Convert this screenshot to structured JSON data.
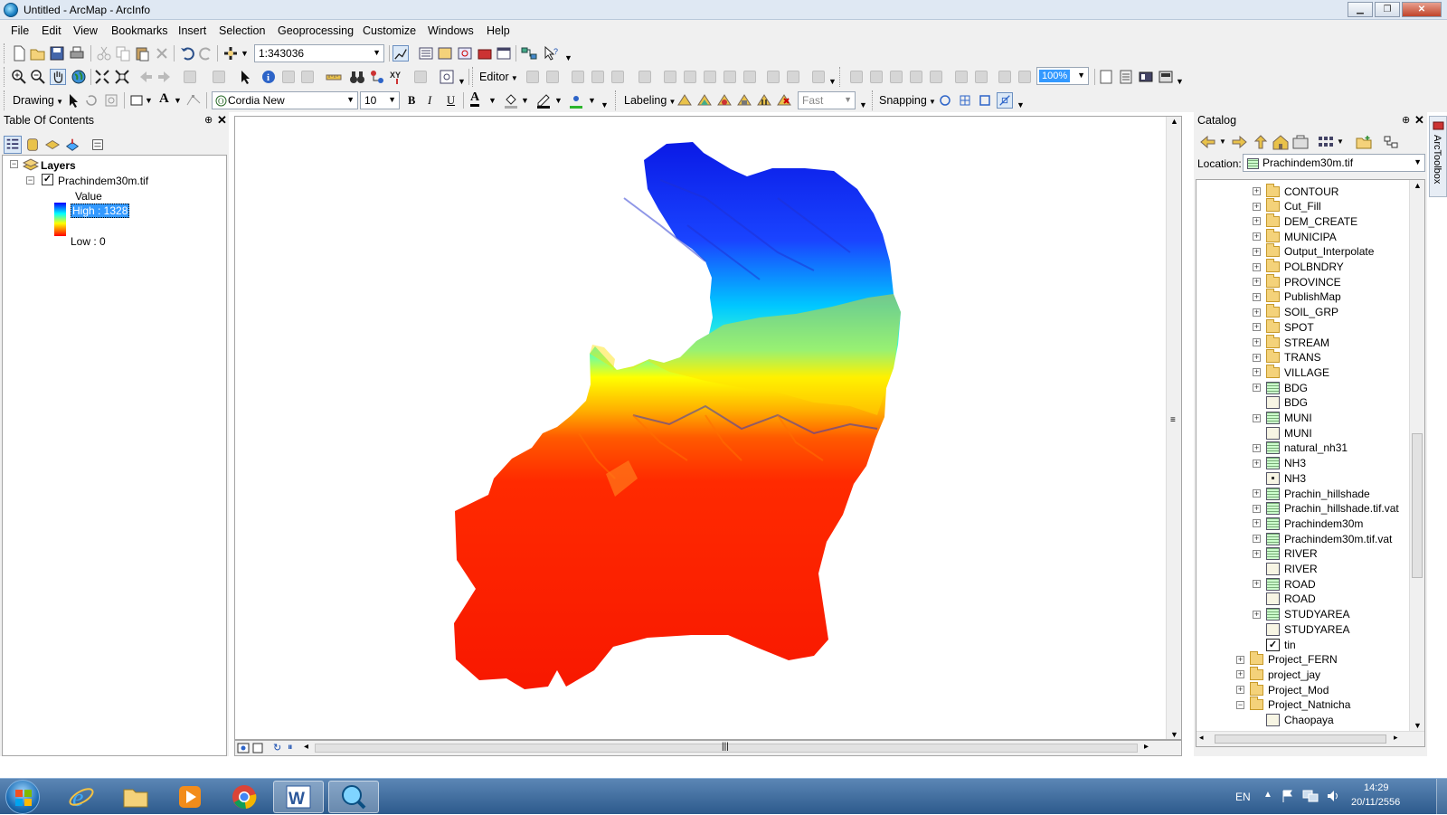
{
  "window": {
    "title": "Untitled - ArcMap - ArcInfo"
  },
  "menu": [
    "File",
    "Edit",
    "View",
    "Bookmarks",
    "Insert",
    "Selection",
    "Geoprocessing",
    "Customize",
    "Windows",
    "Help"
  ],
  "toolbar": {
    "scale": "1:343036",
    "editor": "Editor",
    "zoom_pct": "100%",
    "font_name": "Cordia New",
    "font_size": "10",
    "bold": "B",
    "italic": "I",
    "underline": "U",
    "text_A": "A",
    "drawing": "Drawing",
    "labeling": "Labeling",
    "fast": "Fast",
    "snapping": "Snapping"
  },
  "toc": {
    "title": "Table Of Contents",
    "root": "Layers",
    "layer": "Prachindem30m.tif",
    "field": "Value",
    "high": "High : 1328",
    "low": "Low : 0"
  },
  "catalog": {
    "title": "Catalog",
    "location_label": "Location:",
    "location_value": "Prachindem30m.tif",
    "arctoolbox": "ArcToolbox",
    "items": [
      {
        "label": "CONTOUR",
        "icon": "folder",
        "indent": 1,
        "expander": "+"
      },
      {
        "label": "Cut_Fill",
        "icon": "folder",
        "indent": 1,
        "expander": "+"
      },
      {
        "label": "DEM_CREATE",
        "icon": "folder",
        "indent": 1,
        "expander": "+"
      },
      {
        "label": "MUNICIPA",
        "icon": "folder",
        "indent": 1,
        "expander": "+"
      },
      {
        "label": "Output_Interpolate",
        "icon": "folder",
        "indent": 1,
        "expander": "+"
      },
      {
        "label": "POLBNDRY",
        "icon": "folder",
        "indent": 1,
        "expander": "+"
      },
      {
        "label": "PROVINCE",
        "icon": "folder",
        "indent": 1,
        "expander": "+"
      },
      {
        "label": "PublishMap",
        "icon": "folder",
        "indent": 1,
        "expander": "+"
      },
      {
        "label": "SOIL_GRP",
        "icon": "folder",
        "indent": 1,
        "expander": "+"
      },
      {
        "label": "SPOT",
        "icon": "folder",
        "indent": 1,
        "expander": "+"
      },
      {
        "label": "STREAM",
        "icon": "folder",
        "indent": 1,
        "expander": "+"
      },
      {
        "label": "TRANS",
        "icon": "folder",
        "indent": 1,
        "expander": "+"
      },
      {
        "label": "VILLAGE",
        "icon": "folder",
        "indent": 1,
        "expander": "+"
      },
      {
        "label": "BDG",
        "icon": "raster",
        "indent": 1,
        "expander": "+"
      },
      {
        "label": "BDG",
        "icon": "table",
        "indent": 1,
        "expander": ""
      },
      {
        "label": "MUNI",
        "icon": "raster",
        "indent": 1,
        "expander": "+"
      },
      {
        "label": "MUNI",
        "icon": "table",
        "indent": 1,
        "expander": ""
      },
      {
        "label": "natural_nh31",
        "icon": "raster",
        "indent": 1,
        "expander": "+"
      },
      {
        "label": "NH3",
        "icon": "raster",
        "indent": 1,
        "expander": "+"
      },
      {
        "label": "NH3",
        "icon": "point",
        "indent": 1,
        "expander": ""
      },
      {
        "label": "Prachin_hillshade",
        "icon": "raster",
        "indent": 1,
        "expander": "+"
      },
      {
        "label": "Prachin_hillshade.tif.vat",
        "icon": "raster",
        "indent": 1,
        "expander": "+"
      },
      {
        "label": "Prachindem30m",
        "icon": "raster",
        "indent": 1,
        "expander": "+"
      },
      {
        "label": "Prachindem30m.tif.vat",
        "icon": "raster",
        "indent": 1,
        "expander": "+"
      },
      {
        "label": "RIVER",
        "icon": "raster",
        "indent": 1,
        "expander": "+"
      },
      {
        "label": "RIVER",
        "icon": "table",
        "indent": 1,
        "expander": ""
      },
      {
        "label": "ROAD",
        "icon": "raster",
        "indent": 1,
        "expander": "+"
      },
      {
        "label": "ROAD",
        "icon": "table",
        "indent": 1,
        "expander": ""
      },
      {
        "label": "STUDYAREA",
        "icon": "raster",
        "indent": 1,
        "expander": "+"
      },
      {
        "label": "STUDYAREA",
        "icon": "table",
        "indent": 1,
        "expander": ""
      },
      {
        "label": "tin",
        "icon": "tin",
        "indent": 1,
        "expander": ""
      },
      {
        "label": "Project_FERN",
        "icon": "folder",
        "indent": 0,
        "expander": "+"
      },
      {
        "label": "project_jay",
        "icon": "folder",
        "indent": 0,
        "expander": "+"
      },
      {
        "label": "Project_Mod",
        "icon": "folder",
        "indent": 0,
        "expander": "+"
      },
      {
        "label": "Project_Natnicha",
        "icon": "folder",
        "indent": 0,
        "expander": "-"
      },
      {
        "label": "Chaopaya",
        "icon": "table",
        "indent": 1,
        "expander": ""
      }
    ]
  },
  "taskbar": {
    "lang": "EN",
    "time": "14:29",
    "date": "20/11/2556"
  },
  "colors": {
    "ramp_high": "#0000ff",
    "ramp_mid1": "#00ffff",
    "ramp_mid2": "#ffff00",
    "ramp_low": "#ff0000",
    "selection": "#3399ff"
  }
}
